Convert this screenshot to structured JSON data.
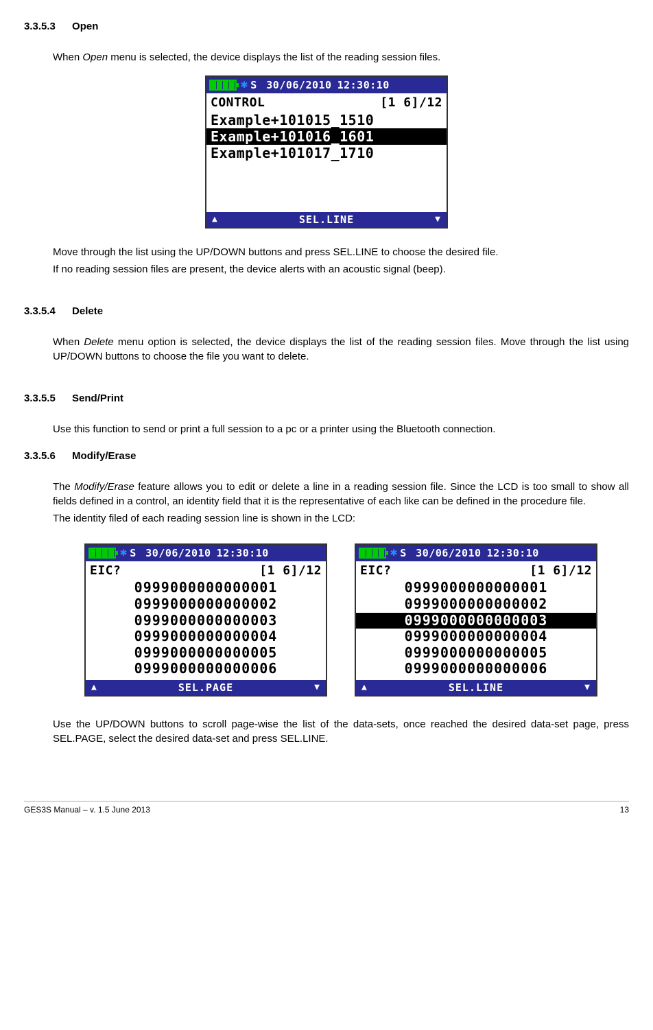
{
  "sections": {
    "s1": {
      "num": "3.3.5.3",
      "title": "Open"
    },
    "s2": {
      "num": "3.3.5.4",
      "title": "Delete"
    },
    "s3": {
      "num": "3.3.5.5",
      "title": "Send/Print"
    },
    "s4": {
      "num": "3.3.5.6",
      "title": "Modify/Erase"
    }
  },
  "p1a": "When ",
  "p1b": "Open",
  "p1c": " menu is selected, the device displays the list of the reading session files.",
  "p2": "Move through the list using the UP/DOWN buttons and press SEL.LINE to choose the desired file.",
  "p3": "If no reading session files are present, the device alerts with an acoustic signal (beep).",
  "p4a": "When ",
  "p4b": "Delete",
  "p4c": " menu option is selected, the device displays the list of the reading session files. Move through the list using UP/DOWN buttons to choose the file you want to delete.",
  "p5": "Use this function to send or print a full session to a pc or a printer using the Bluetooth connection.",
  "p6a": "The ",
  "p6b": "Modify/Erase",
  "p6c": " feature allows you to edit or delete a line in a reading session file. Since the LCD is too small to show all fields defined in a control, an identity field that it is the representative of each like can be defined in the procedure file.",
  "p7": "The identity filed of each reading session line is shown in the LCD:",
  "p8": "Use the UP/DOWN buttons to scroll page-wise the list of the data-sets, once reached the desired data-set page, press SEL.PAGE, select the desired data-set and press SEL.LINE.",
  "lcd1": {
    "status": {
      "s": "S",
      "date": "30/06/2010",
      "time": "12:30:10"
    },
    "title_left": "CONTROL",
    "title_right": "[1 6]/12",
    "lines": [
      "Example+101015_1510",
      "Example+101016_1601",
      "Example+101017_1710"
    ],
    "selected": 1,
    "footer": "SEL.LINE"
  },
  "lcd2": {
    "status": {
      "s": "S",
      "date": "30/06/2010",
      "time": "12:30:10"
    },
    "title_left": "EIC?",
    "title_right": "[1 6]/12",
    "lines": [
      "0999000000000001",
      "0999000000000002",
      "0999000000000003",
      "0999000000000004",
      "0999000000000005",
      "0999000000000006"
    ],
    "footer": "SEL.PAGE"
  },
  "lcd3": {
    "status": {
      "s": "S",
      "date": "30/06/2010",
      "time": "12:30:10"
    },
    "title_left": "EIC?",
    "title_right": "[1 6]/12",
    "lines": [
      "0999000000000001",
      "0999000000000002",
      "0999000000000003",
      "0999000000000004",
      "0999000000000005",
      "0999000000000006"
    ],
    "selected": 2,
    "footer": "SEL.LINE"
  },
  "footer_left": "GES3S Manual – v. 1.5  June 2013",
  "footer_right": "13"
}
